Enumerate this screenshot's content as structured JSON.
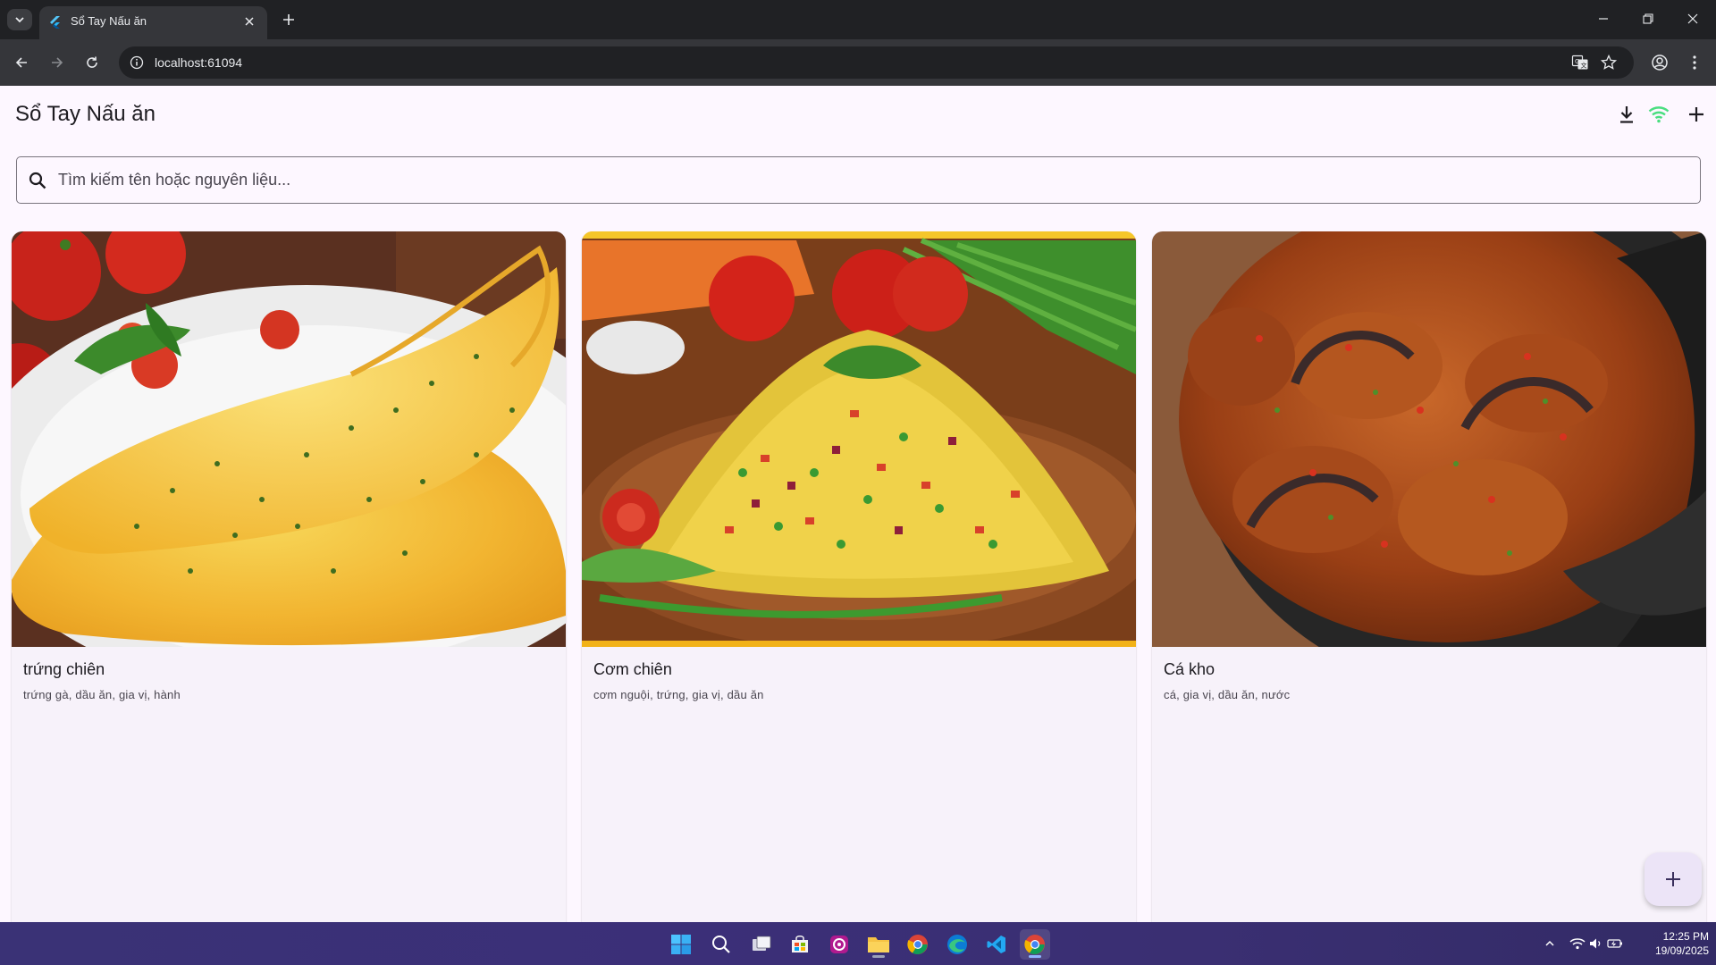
{
  "browser": {
    "tab_title": "Sổ Tay Nấu ăn",
    "url": "localhost:61094"
  },
  "app": {
    "title": "Sổ Tay Nấu ăn",
    "search_placeholder": "Tìm kiếm tên hoặc nguyên liệu...",
    "search_value": "",
    "connection_status_color": "#4ade80",
    "actions": [
      "download-icon",
      "wifi-icon",
      "add-icon"
    ]
  },
  "recipes": [
    {
      "title": "trứng chiên",
      "ingredients": "trứng gà, dầu ăn, gia vị, hành",
      "image": "omelette"
    },
    {
      "title": "Cơm chiên",
      "ingredients": "cơm nguội, trứng, gia vị, dầu ăn",
      "image": "fried-rice"
    },
    {
      "title": "Cá kho",
      "ingredients": "cá, gia vị, dầu ăn, nước",
      "image": "braised-fish"
    }
  ],
  "fab": {
    "icon": "add-icon"
  },
  "taskbar": {
    "apps": [
      "windows-start",
      "search",
      "task-view",
      "microsoft-store",
      "app-icon",
      "file-explorer",
      "chrome",
      "edge",
      "vscode",
      "chrome-active"
    ],
    "time": "12:25 PM",
    "date": "19/09/2025"
  }
}
